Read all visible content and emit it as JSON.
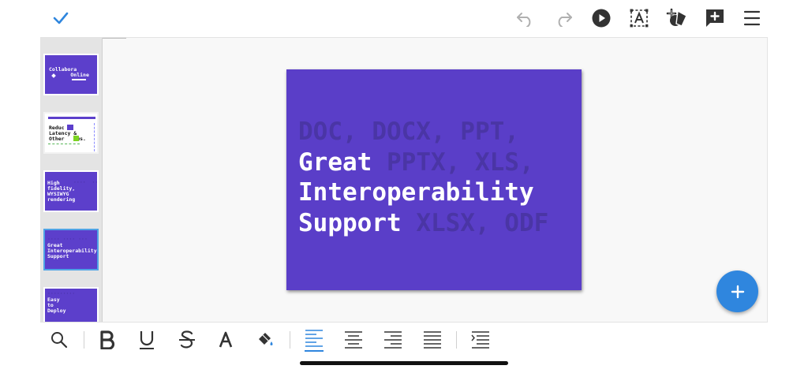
{
  "colors": {
    "accent": "#2f86de",
    "slide_bg": "#5a3ec8",
    "icon": "#333333",
    "icon_disabled": "#b0b0b0"
  },
  "toolbar_top": {
    "icons": [
      "check-icon",
      "undo-icon",
      "redo-icon",
      "play-icon",
      "text-box-icon",
      "insert-shape-icon",
      "add-comment-icon",
      "menu-icon"
    ]
  },
  "slide_panel": {
    "thumbnails": [
      {
        "lines": [
          "Collabora",
          "       Online"
        ]
      },
      {
        "lines": [
          "Reduc ed",
          "Latency &",
          "Other    ws."
        ]
      },
      {
        "lines": [
          "High",
          "fidelity,",
          "WYSIWYG",
          "rendering"
        ]
      },
      {
        "lines": [
          "Great",
          "Interoperability",
          "Support"
        ]
      },
      {
        "lines": [
          "Easy",
          "to",
          "Deploy"
        ]
      }
    ]
  },
  "slide": {
    "line1_ghost": "DOC, DOCX, PPT,",
    "line2_title": "Great",
    "line2_ghost": " PPTX, XLS,",
    "line3_title": "Interoperability",
    "line4_title": "Support",
    "line4_ghost": " XLSX, ODF"
  },
  "toolbar_bottom": {
    "icons": [
      "search-icon",
      "bold-icon",
      "underline-icon",
      "strikethrough-icon",
      "font-color-icon",
      "highlight-icon",
      "align-left-icon",
      "align-center-icon",
      "align-right-icon",
      "justify-icon",
      "list-icon"
    ],
    "active": "align-left-icon"
  }
}
